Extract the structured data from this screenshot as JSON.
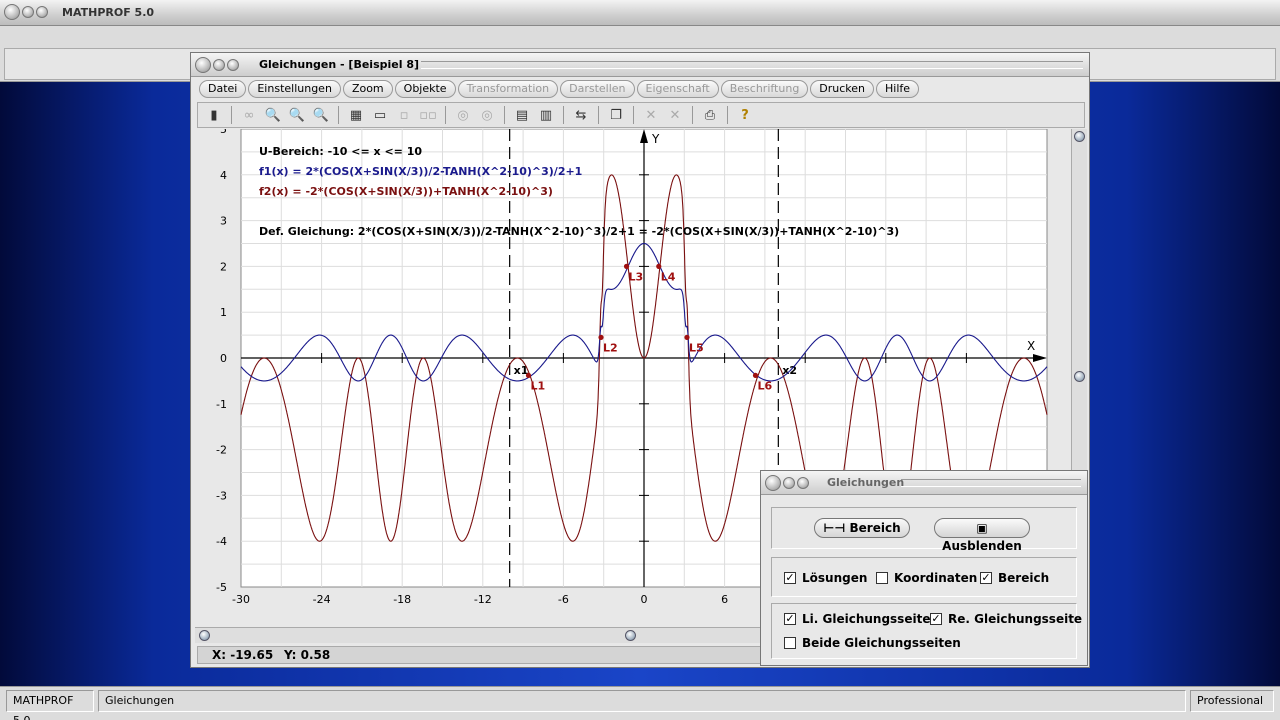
{
  "app": {
    "title": "MATHPROF 5.0"
  },
  "window": {
    "title": "Gleichungen - [Beispiel 8]"
  },
  "menu": [
    {
      "label": "Datei",
      "enabled": true
    },
    {
      "label": "Einstellungen",
      "enabled": true
    },
    {
      "label": "Zoom",
      "enabled": true
    },
    {
      "label": "Objekte",
      "enabled": true
    },
    {
      "label": "Transformation",
      "enabled": false
    },
    {
      "label": "Darstellen",
      "enabled": false
    },
    {
      "label": "Eigenschaft",
      "enabled": false
    },
    {
      "label": "Beschriftung",
      "enabled": false
    },
    {
      "label": "Drucken",
      "enabled": true
    },
    {
      "label": "Hilfe",
      "enabled": true
    }
  ],
  "toolbar": {
    "icons": [
      "phone-icon",
      "glasses-icon",
      "zoom-out-icon",
      "zoom-reset-icon",
      "zoom-in-icon",
      "properties-icon",
      "window-icon",
      "grid-small-icon",
      "grid-dual-icon",
      "target-icon",
      "target-alt-icon",
      "table-icon",
      "table-alt-icon",
      "transfer-icon",
      "copy-icon",
      "delete-icon",
      "delete-alt-icon",
      "print-icon",
      "help-icon"
    ]
  },
  "plot": {
    "info": {
      "range": "U-Bereich: -10 <= x <= 10",
      "f1": "f1(x) = 2*(COS(X+SIN(X/3))/2-TANH(X^2-10)^3)/2+1",
      "f2": "f2(x) = -2*(COS(X+SIN(X/3))+TANH(X^2-10)^3)",
      "def": "Def. Gleichung: 2*(COS(X+SIN(X/3))/2-TANH(X^2-10)^3)/2+1 = -2*(COS(X+SIN(X/3))+TANH(X^2-10)^3)"
    },
    "colors": {
      "f1": "#1a1a8c",
      "f2": "#7a1010",
      "points": "#a01010"
    },
    "x_axis_label": "X",
    "y_axis_label": "Y",
    "x_ticks": [
      "-30",
      "-24",
      "-18",
      "-12",
      "-6",
      "0",
      "6"
    ],
    "y_ticks": [
      "5",
      "4",
      "3",
      "2",
      "1",
      "0",
      "-1",
      "-2",
      "-3",
      "-4",
      "-5"
    ],
    "xlim": [
      -30,
      30
    ],
    "ylim": [
      -5,
      5
    ],
    "bounds": [
      {
        "label": "x1",
        "x": -10
      },
      {
        "label": "x2",
        "x": 10
      }
    ],
    "solutions": [
      {
        "label": "L1",
        "x": -8.6,
        "y": -0.38
      },
      {
        "label": "L2",
        "x": -3.2,
        "y": 0.45
      },
      {
        "label": "L3",
        "x": -1.3,
        "y": 2.0
      },
      {
        "label": "L4",
        "x": 1.1,
        "y": 2.0
      },
      {
        "label": "L5",
        "x": 3.2,
        "y": 0.45
      },
      {
        "label": "L6",
        "x": 8.3,
        "y": -0.38
      }
    ]
  },
  "coords": {
    "x": "X: -19.65",
    "y": "Y: 0.58"
  },
  "dialog": {
    "title": "Gleichungen",
    "btn_bereich": "Bereich",
    "btn_ausblenden": "Ausblenden",
    "checks": [
      {
        "label": "Lösungen",
        "checked": true
      },
      {
        "label": "Koordinaten",
        "checked": false
      },
      {
        "label": "Bereich",
        "checked": true
      },
      {
        "label": "Li. Gleichungsseite",
        "checked": true
      },
      {
        "label": "Re. Gleichungsseite",
        "checked": true
      },
      {
        "label": "Beide Gleichungsseiten",
        "checked": false
      }
    ]
  },
  "status": {
    "app": "MATHPROF 5.0",
    "module": "Gleichungen",
    "edition": "Professional"
  }
}
